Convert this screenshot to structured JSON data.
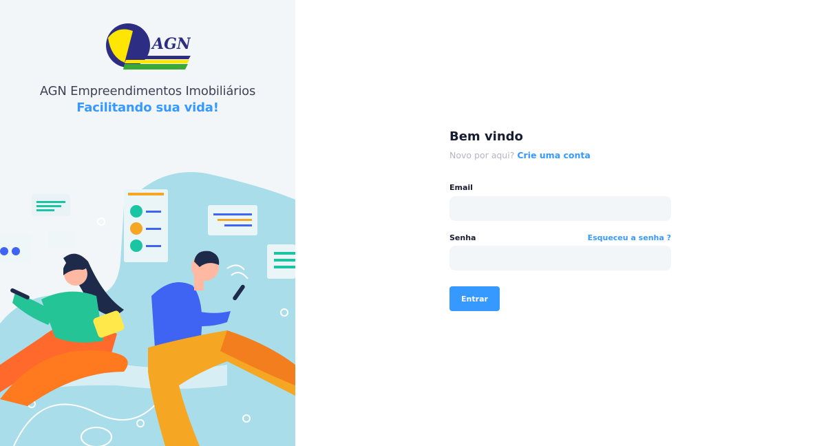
{
  "brand": {
    "logo_text": "AGN",
    "title": "AGN Empreendimentos Imobiliários",
    "subtitle": "Facilitando sua vida!"
  },
  "login": {
    "heading": "Bem vindo",
    "prompt": "Novo por aqui?",
    "signup_link": "Crie uma conta",
    "email_label": "Email",
    "email_value": "",
    "password_label": "Senha",
    "password_value": "",
    "forgot_link": "Esqueceu a senha ?",
    "submit_label": "Entrar"
  },
  "colors": {
    "accent": "#3699ff",
    "aside_bg": "#f3f6f9",
    "input_bg": "#f3f6f9",
    "heading": "#181c32",
    "muted": "#b5b5c3"
  }
}
